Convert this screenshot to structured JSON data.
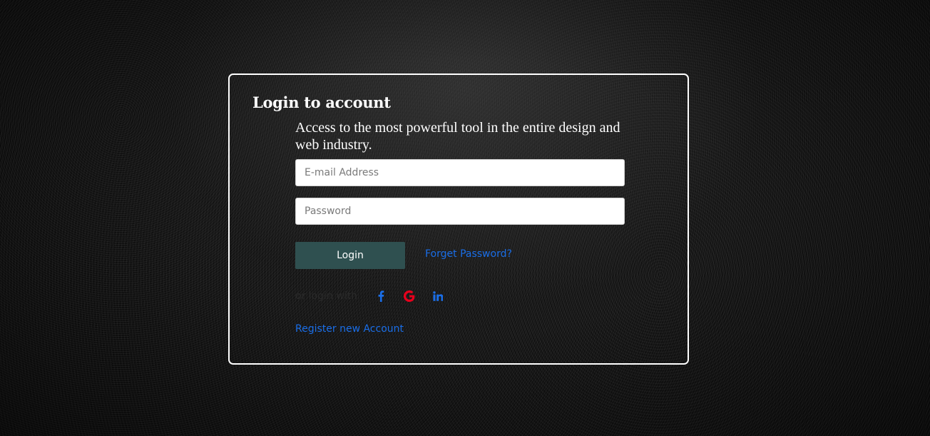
{
  "login_card": {
    "title": "Login to account",
    "subtitle": "Access to the most powerful tool in the entire design and web industry.",
    "email_placeholder": "E-mail Address",
    "password_placeholder": "Password",
    "login_button": "Login",
    "forget_password": "Forget Password?",
    "social_label": "or login with",
    "social_icons": [
      "facebook-icon",
      "google-icon",
      "linkedin-icon"
    ],
    "register_link": "Register new Account"
  },
  "colors": {
    "background": "#141414",
    "card_border": "#ffffff",
    "login_button": "#2f5050",
    "link": "#1a6ee8",
    "facebook": "#1a6ee8",
    "google": "#e8001c",
    "linkedin": "#1a6ee8"
  }
}
